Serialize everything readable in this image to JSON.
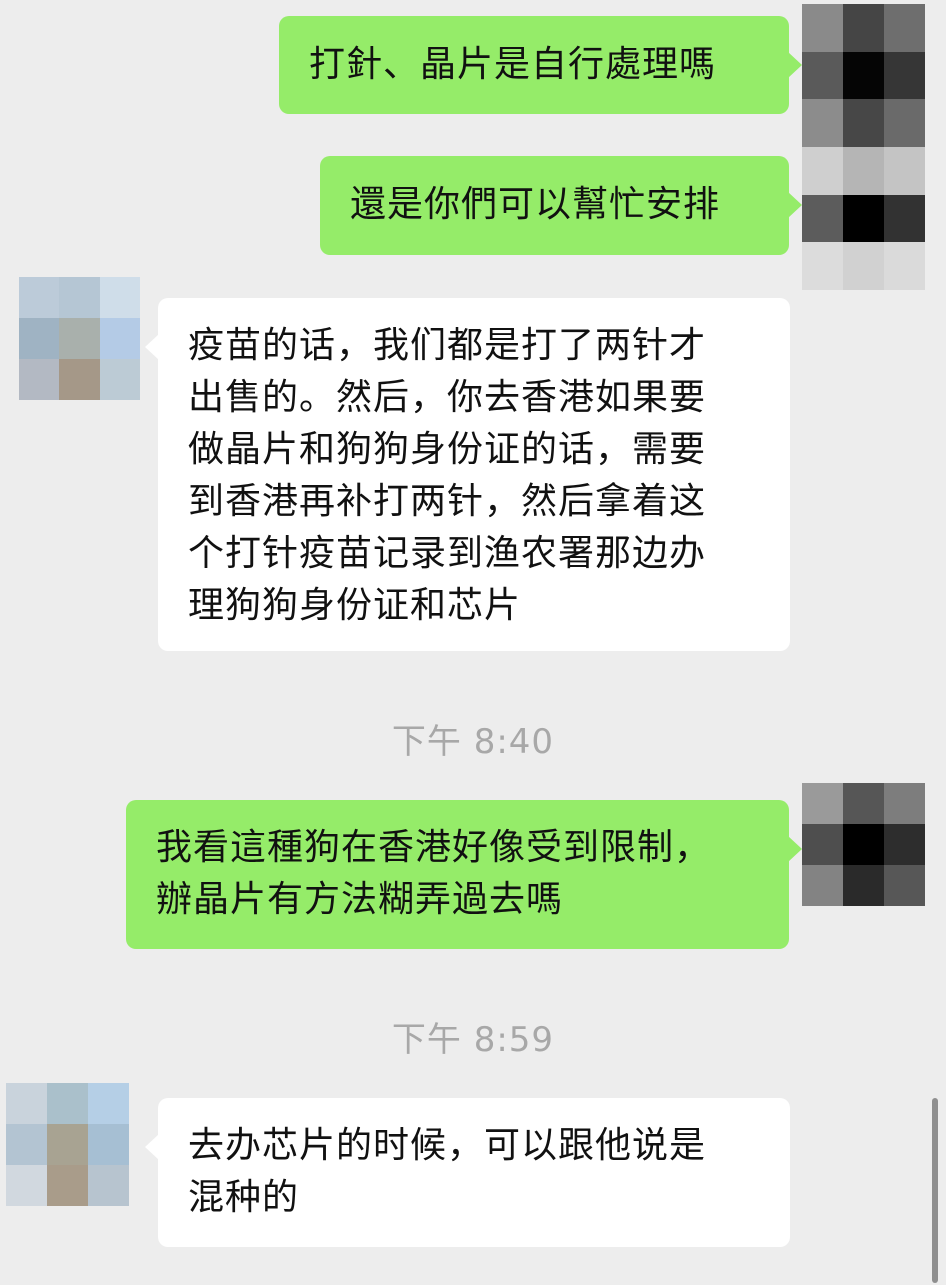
{
  "messages": [
    {
      "side": "out",
      "text": "打針、晶片是自行處理嗎"
    },
    {
      "side": "out",
      "text": "還是你們可以幫忙安排"
    },
    {
      "side": "in",
      "text": "疫苗的话，我们都是打了两针才\n出售的。然后，你去香港如果要\n做晶片和狗狗身份证的话，需要\n到香港再补打两针，然后拿着这\n个打针疫苗记录到渔农署那边办\n理狗狗身份证和芯片"
    },
    {
      "side": "out",
      "text": "我看這種狗在香港好像受到限制，\n辦晶片有方法糊弄過去嗎"
    },
    {
      "side": "in",
      "text": "去办芯片的时候，可以跟他说是\n混种的"
    }
  ],
  "timestamps": [
    "下午 8:40",
    "下午 8:59"
  ],
  "colors": {
    "background": "#ededed",
    "outgoing_bubble": "#95ec69",
    "incoming_bubble": "#ffffff",
    "timestamp_text": "#a8a8a8"
  },
  "avatars": {
    "self": {
      "icon": "pixelated-avatar",
      "pixels": [
        "#8a8a8a",
        "#454545",
        "#6e6e6e",
        "#5a5a5a",
        "#050505",
        "#363636",
        "#8c8c8c",
        "#474747",
        "#6a6a6a",
        "#cfcfcf",
        "#b5b5b5",
        "#c4c4c4",
        "#5c5c5c",
        "#000000",
        "#323232",
        "#dcdcdc",
        "#d1d1d1",
        "#dadada"
      ]
    },
    "self_2": {
      "icon": "pixelated-avatar",
      "pixels": [
        "#9a9a9a",
        "#565656",
        "#7d7d7d",
        "#4e4e4e",
        "#000000",
        "#2d2d2d",
        "#838383",
        "#2a2a2a",
        "#575757"
      ]
    },
    "contact_1": {
      "icon": "pixelated-avatar",
      "pixels": [
        "#bccbd9",
        "#b5c6d4",
        "#cfdde9",
        "#9fb3c3",
        "#a9b0ac",
        "#b4cbe6",
        "#b3b9c3",
        "#a59888",
        "#bccbd5"
      ]
    },
    "contact_2": {
      "icon": "pixelated-avatar",
      "pixels": [
        "#c9d3dc",
        "#aac0cb",
        "#b5cfe6",
        "#b3c4d2",
        "#a8a392",
        "#a6bfd3",
        "#d1d8df",
        "#a99c8a",
        "#b7c4cf"
      ]
    }
  }
}
